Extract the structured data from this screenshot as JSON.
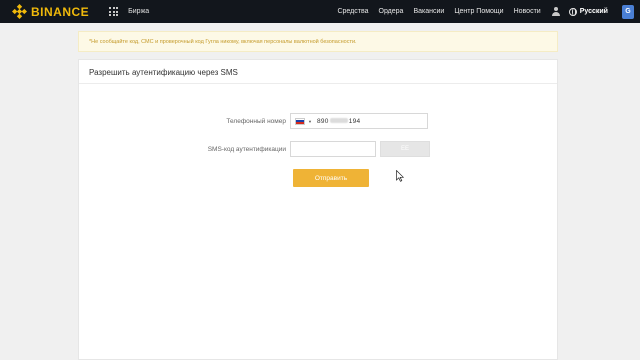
{
  "header": {
    "brand": "BINANCE",
    "birzha": "Биржа",
    "nav": [
      "Средства",
      "Ордера",
      "Вакансии",
      "Центр Помощи",
      "Новости"
    ],
    "language": "Русский",
    "translate_glyph": "G"
  },
  "warning": {
    "text": "*Не сообщайте код, СМС и проверочный код Гугла никому, включая персоналы валютной безопасности."
  },
  "panel": {
    "title": "Разрешить аутентификацию через SMS",
    "phone_label": "Телефонный номер",
    "phone_prefix": "890",
    "phone_suffix": "194",
    "sms_label": "SMS-код аутентификации",
    "sms_value": "",
    "send_code_label": "ЕЕ",
    "submit_label": "Отправить"
  },
  "colors": {
    "brand": "#f0b90b",
    "submit": "#efb336",
    "header_bg": "#12161c",
    "warning_text": "#c49a2a",
    "warning_bg": "#fdf9e6"
  },
  "icons": [
    "binance-logo-icon",
    "apps-grid-icon",
    "user-icon",
    "globe-icon",
    "translate-icon",
    "russia-flag-icon",
    "dropdown-caret-icon",
    "mouse-cursor-icon"
  ]
}
